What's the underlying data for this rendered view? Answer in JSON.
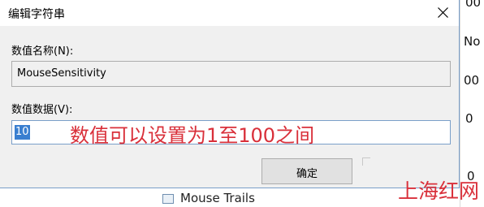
{
  "background": {
    "fragments": [
      "00",
      "No",
      "00",
      "0",
      "0",
      "0"
    ],
    "list_item_text": "Mouse Trails"
  },
  "dialog": {
    "title": "编辑字符串",
    "value_name_label": "数值名称(N):",
    "value_name": "MouseSensitivity",
    "value_data_label": "数值数据(V):",
    "value_data": "10",
    "ok_button": "确定"
  },
  "annotation": {
    "text": "数值可以设置为1至100之间",
    "color": "#d9303a"
  },
  "watermark": "上海红网",
  "colors": {
    "selection": "#3a7fd0",
    "window_bg": "#f0f0f0",
    "border_accent": "#7a9fc9"
  }
}
